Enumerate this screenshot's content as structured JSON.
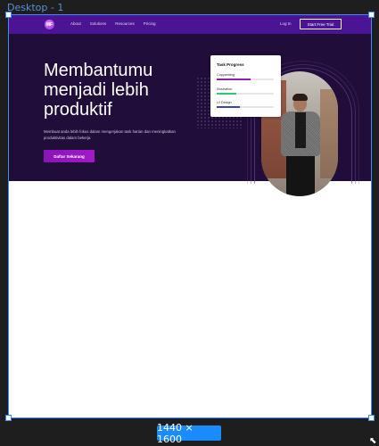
{
  "editor": {
    "frame_label": "Desktop - 1",
    "size_badge": "1440 × 1600"
  },
  "nav": {
    "logo_text": "MF",
    "links": [
      "About",
      "Solutions",
      "Resources",
      "Pricing"
    ],
    "login": "Log In",
    "cta": "Start Free Trial"
  },
  "hero": {
    "headline": "Membantumu menjadi lebih produktif",
    "subtext": "Membuat anda lebih fokus dalam mengerjakan task harian dan meningkatkan produktivitas dalam bekerja.",
    "cta": "Daftar Sekarang"
  },
  "task_card": {
    "title": "Task Progress",
    "items": [
      {
        "name": "Copywriting",
        "progress": 0.6,
        "color": "#8e24aa"
      },
      {
        "name": "Illustration",
        "progress": 0.35,
        "color": "#2ecc71"
      },
      {
        "name": "UI Design",
        "progress": 0.4,
        "color": "#3949ab"
      }
    ]
  },
  "colors": {
    "navbar": "#4b1494",
    "hero_bg": "#200d3a",
    "accent": "#a21ac7",
    "selection": "#3d8bfd"
  }
}
